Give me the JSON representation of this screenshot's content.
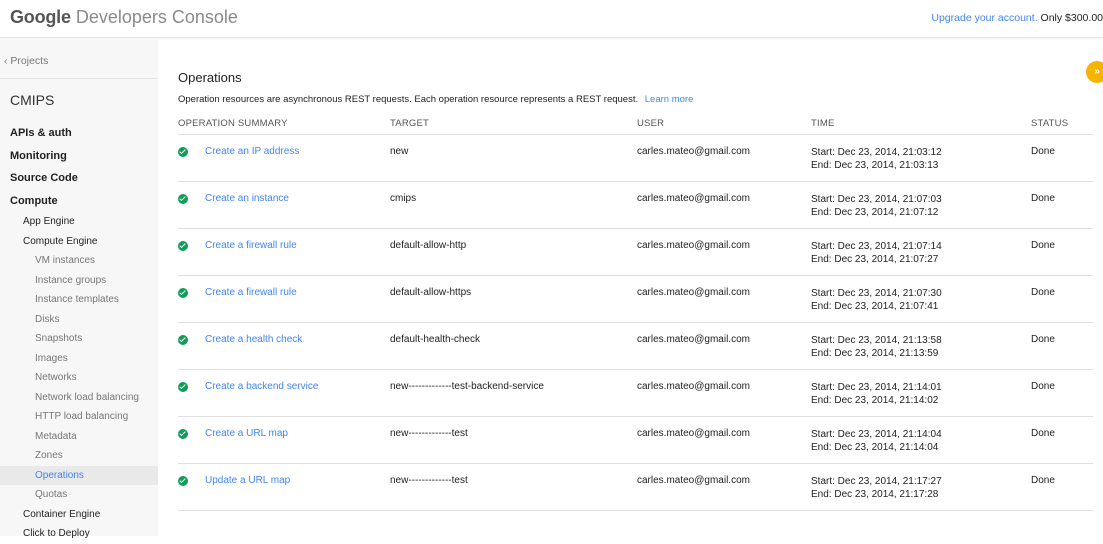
{
  "header": {
    "logo_google": "Google",
    "logo_rest": "Developers Console",
    "upgrade_link": "Upgrade your account.",
    "upgrade_text": "Only $300.00"
  },
  "sidebar": {
    "projects_label": "Projects",
    "project_name": "CMIPS",
    "items": [
      {
        "label": "APIs & auth",
        "level": 1
      },
      {
        "label": "Monitoring",
        "level": 1
      },
      {
        "label": "Source Code",
        "level": 1
      },
      {
        "label": "Compute",
        "level": 1
      },
      {
        "label": "App Engine",
        "level": 2
      },
      {
        "label": "Compute Engine",
        "level": 2
      },
      {
        "label": "VM instances",
        "level": 3
      },
      {
        "label": "Instance groups",
        "level": 3
      },
      {
        "label": "Instance templates",
        "level": 3
      },
      {
        "label": "Disks",
        "level": 3
      },
      {
        "label": "Snapshots",
        "level": 3
      },
      {
        "label": "Images",
        "level": 3
      },
      {
        "label": "Networks",
        "level": 3
      },
      {
        "label": "Network load balancing",
        "level": 3
      },
      {
        "label": "HTTP load balancing",
        "level": 3
      },
      {
        "label": "Metadata",
        "level": 3
      },
      {
        "label": "Zones",
        "level": 3
      },
      {
        "label": "Operations",
        "level": 3,
        "active": true
      },
      {
        "label": "Quotas",
        "level": 3
      },
      {
        "label": "Container Engine",
        "level": 2
      },
      {
        "label": "Click to Deploy",
        "level": 2
      }
    ]
  },
  "main": {
    "title": "Operations",
    "description": "Operation resources are asynchronous REST requests. Each operation resource represents a REST request.",
    "learn_more": "Learn more",
    "collapse_icon": "»",
    "columns": {
      "summary": "OPERATION SUMMARY",
      "target": "TARGET",
      "user": "USER",
      "time": "TIME",
      "status": "STATUS"
    },
    "rows": [
      {
        "summary": "Create an IP address",
        "target": "new",
        "user": "carles.mateo@gmail.com",
        "start": "Start: Dec 23, 2014, 21:03:12",
        "end": "End: Dec 23, 2014, 21:03:13",
        "status": "Done"
      },
      {
        "summary": "Create an instance",
        "target": "cmips",
        "user": "carles.mateo@gmail.com",
        "start": "Start: Dec 23, 2014, 21:07:03",
        "end": "End: Dec 23, 2014, 21:07:12",
        "status": "Done"
      },
      {
        "summary": "Create a firewall rule",
        "target": "default-allow-http",
        "user": "carles.mateo@gmail.com",
        "start": "Start: Dec 23, 2014, 21:07:14",
        "end": "End: Dec 23, 2014, 21:07:27",
        "status": "Done"
      },
      {
        "summary": "Create a firewall rule",
        "target": "default-allow-https",
        "user": "carles.mateo@gmail.com",
        "start": "Start: Dec 23, 2014, 21:07:30",
        "end": "End: Dec 23, 2014, 21:07:41",
        "status": "Done"
      },
      {
        "summary": "Create a health check",
        "target": "default-health-check",
        "user": "carles.mateo@gmail.com",
        "start": "Start: Dec 23, 2014, 21:13:58",
        "end": "End: Dec 23, 2014, 21:13:59",
        "status": "Done"
      },
      {
        "summary": "Create a backend service",
        "target": "new-------------test-backend-service",
        "user": "carles.mateo@gmail.com",
        "start": "Start: Dec 23, 2014, 21:14:01",
        "end": "End: Dec 23, 2014, 21:14:02",
        "status": "Done"
      },
      {
        "summary": "Create a URL map",
        "target": "new-------------test",
        "user": "carles.mateo@gmail.com",
        "start": "Start: Dec 23, 2014, 21:14:04",
        "end": "End: Dec 23, 2014, 21:14:04",
        "status": "Done"
      },
      {
        "summary": "Update a URL map",
        "target": "new-------------test",
        "user": "carles.mateo@gmail.com",
        "start": "Start: Dec 23, 2014, 21:17:27",
        "end": "End: Dec 23, 2014, 21:17:28",
        "status": "Done"
      }
    ]
  },
  "colors": {
    "accent": "#4285f4",
    "success": "#0f9d58",
    "collapse_button": "#f4b400"
  },
  "icons": {
    "status": "check-circle-icon",
    "back": "chevron-left-icon",
    "collapse": "double-chevron-right-icon"
  }
}
